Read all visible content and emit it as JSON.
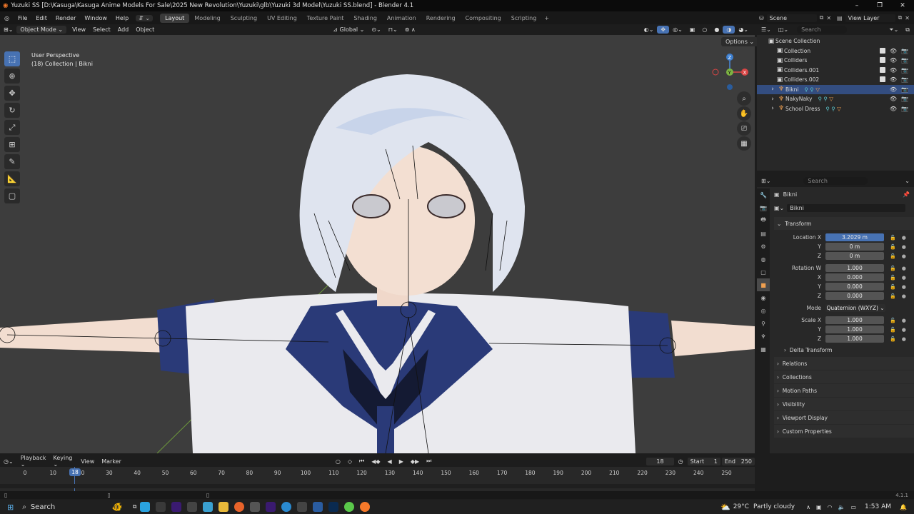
{
  "window": {
    "title": "Yuzuki SS [D:\\Kasuga\\Kasuga Anime Models For Sale\\2025 New Revolution\\Yuzuki\\glb\\Yuzuki 3d Model\\Yuzuki SS.blend] - Blender 4.1",
    "min": "–",
    "max": "❐",
    "close": "✕"
  },
  "menubar": {
    "menus": [
      "File",
      "Edit",
      "Render",
      "Window",
      "Help"
    ],
    "workspaces": [
      "Layout",
      "Modeling",
      "Sculpting",
      "UV Editing",
      "Texture Paint",
      "Shading",
      "Animation",
      "Rendering",
      "Compositing",
      "Scripting"
    ],
    "active_workspace": "Layout",
    "scene": "Scene",
    "view_layer": "View Layer"
  },
  "viewport_header": {
    "mode": "Object Mode",
    "menus": [
      "View",
      "Select",
      "Add",
      "Object"
    ],
    "orientation": "Global",
    "options": "Options"
  },
  "viewport_info": {
    "line1": "User Perspective",
    "line2": "(18) Collection | Bikni"
  },
  "gizmo": {
    "x": "X",
    "y": "Y",
    "z": "Z"
  },
  "outliner": {
    "search_placeholder": "Search",
    "root": "Scene Collection",
    "items": [
      {
        "label": "Collection",
        "type": "collection"
      },
      {
        "label": "Colliders",
        "type": "collection"
      },
      {
        "label": "Colliders.001",
        "type": "collection"
      },
      {
        "label": "Colliders.002",
        "type": "collection"
      },
      {
        "label": "Bikni",
        "type": "armature",
        "selected": true
      },
      {
        "label": "NakyNaky",
        "type": "armature"
      },
      {
        "label": "School Dress",
        "type": "armature"
      }
    ]
  },
  "properties": {
    "search_placeholder": "Search",
    "object_name": "Bikni",
    "object_field": "Bikni",
    "transform_title": "Transform",
    "location": {
      "label": "Location X",
      "x": "3.2029 m",
      "y": "0 m",
      "z": "0 m"
    },
    "rotation": {
      "label": "Rotation W",
      "w": "1.000",
      "x": "0.000",
      "y": "0.000",
      "z": "0.000"
    },
    "mode_label": "Mode",
    "mode": "Quaternion (WXYZ)",
    "scale": {
      "label": "Scale X",
      "x": "1.000",
      "y": "1.000",
      "z": "1.000"
    },
    "axis_labels": {
      "y": "Y",
      "z": "Z",
      "x": "X"
    },
    "sections": [
      "Delta Transform",
      "Relations",
      "Collections",
      "Motion Paths",
      "Visibility",
      "Viewport Display",
      "Custom Properties"
    ]
  },
  "timeline": {
    "menus": [
      "Playback",
      "Keying",
      "View",
      "Marker"
    ],
    "current_frame": "18",
    "start_label": "Start",
    "start": "1",
    "end_label": "End",
    "end": "250",
    "ticks": [
      "0",
      "10",
      "20",
      "30",
      "40",
      "50",
      "60",
      "70",
      "80",
      "90",
      "100",
      "110",
      "120",
      "130",
      "140",
      "150",
      "160",
      "170",
      "180",
      "190",
      "200",
      "210",
      "220",
      "230",
      "240",
      "250"
    ],
    "playhead": "18"
  },
  "status": {
    "version": "4.1.1"
  },
  "taskbar": {
    "search": "Search",
    "weather_temp": "29°C",
    "weather_text": "Partly cloudy",
    "time": "1:53 AM"
  },
  "colors": {
    "accent": "#4772b3",
    "selected_row": "#334d80",
    "viewport": "#3d3d3d",
    "sailor_navy": "#2a3a78"
  }
}
